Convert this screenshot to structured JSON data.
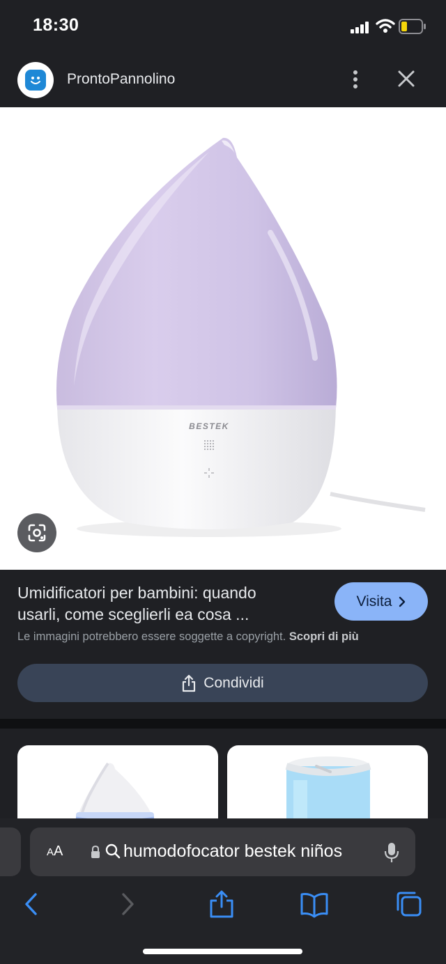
{
  "status": {
    "time": "18:30"
  },
  "header": {
    "site_name": "ProntoPannolino"
  },
  "product": {
    "brand_mark": "BESTEK"
  },
  "result": {
    "title": "Umidificatori per bambini: quando\nusarli, come sceglierli ea cosa ...",
    "visit_label": "Visita",
    "copyright_text": "Le immagini potrebbero essere soggette a copyright.",
    "learn_more": "Scopri di più",
    "share_label": "Condividi"
  },
  "browser": {
    "aa_small": "A",
    "aa_big": "A",
    "url": "humodofocator bestek niños"
  },
  "icons": {
    "signal": "signal-icon",
    "wifi": "wifi-icon",
    "battery": "battery-low-icon",
    "more": "more-vert-icon",
    "close": "close-icon",
    "lens": "lens-icon",
    "chevron": "chevron-right-icon",
    "share": "share-icon",
    "lock": "lock-icon",
    "search": "search-icon",
    "mic": "microphone-icon",
    "back": "back-icon",
    "forward": "forward-icon",
    "bookmarks": "bookmarks-icon",
    "tabs": "tabs-icon"
  },
  "colors": {
    "accent": "#8ab4f8",
    "share_bg": "#394457",
    "battery": "#f5d60a",
    "safari_link": "#3a8ef6"
  }
}
